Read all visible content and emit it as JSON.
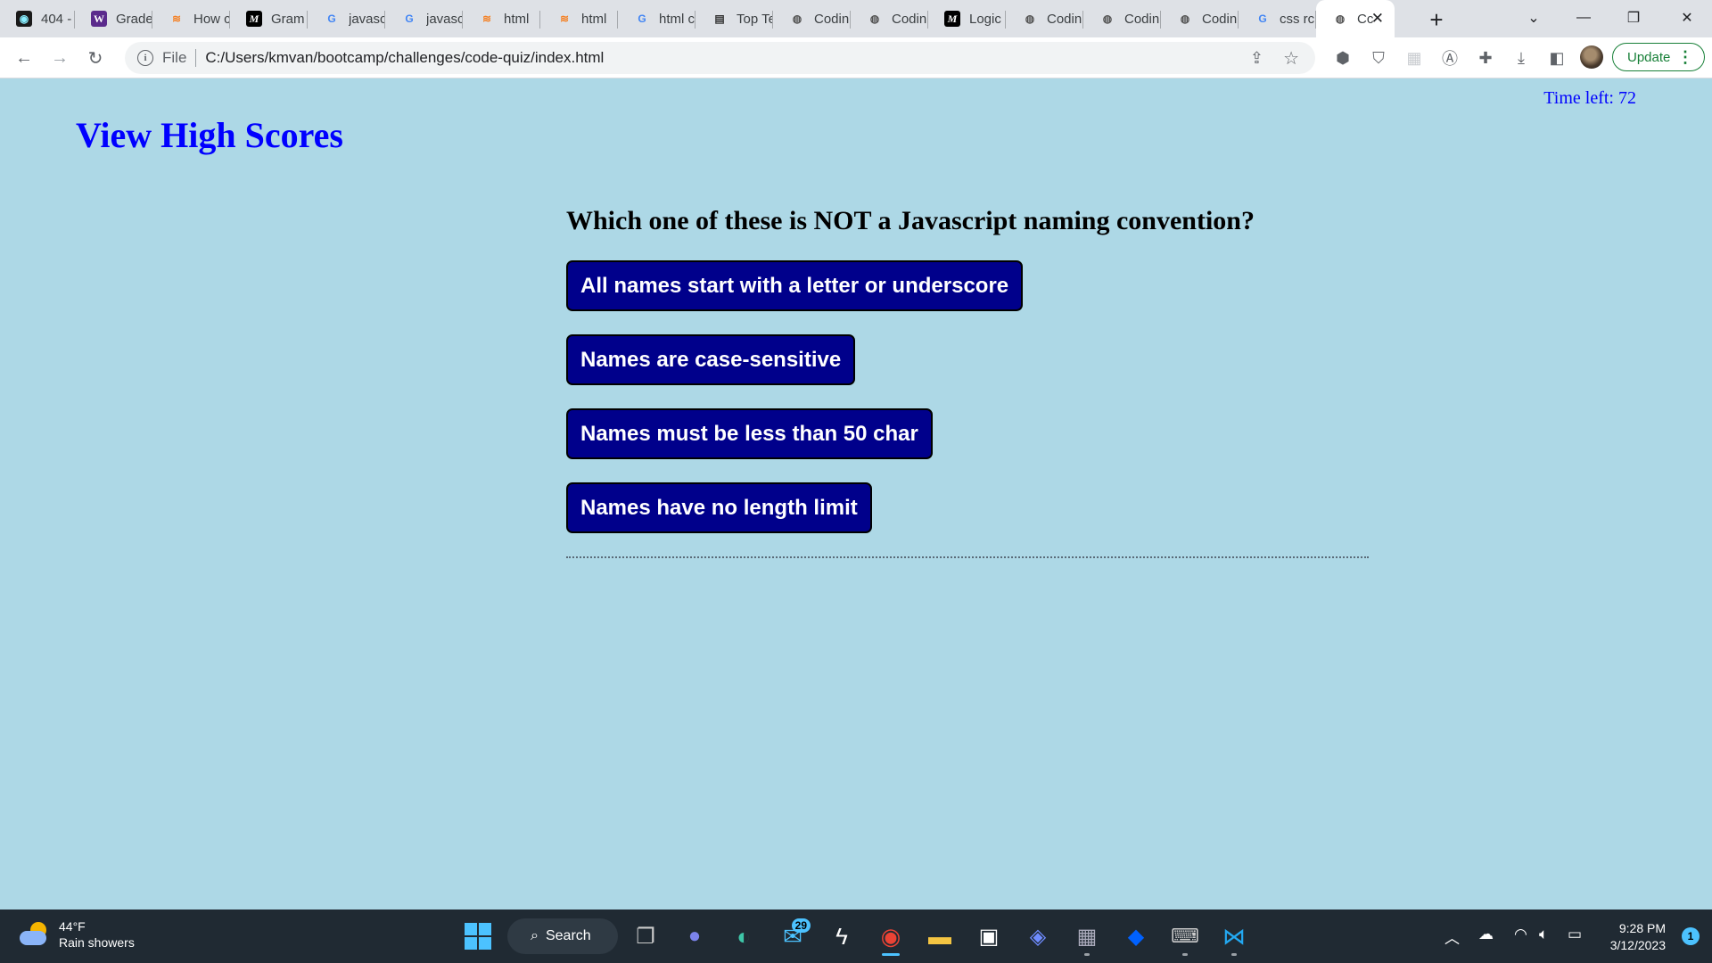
{
  "browser": {
    "tabs": [
      {
        "title": "404 -",
        "icon": "dark-circle-icon"
      },
      {
        "title": "Grade",
        "icon": "w-icon"
      },
      {
        "title": "How c",
        "icon": "stackoverflow-icon"
      },
      {
        "title": "Gram",
        "icon": "m-icon"
      },
      {
        "title": "javasc",
        "icon": "google-icon"
      },
      {
        "title": "javasc",
        "icon": "google-icon"
      },
      {
        "title": "html",
        "icon": "stackoverflow-icon"
      },
      {
        "title": "html",
        "icon": "stackoverflow-icon"
      },
      {
        "title": "html c",
        "icon": "google-icon"
      },
      {
        "title": "Top Te",
        "icon": "news-icon"
      },
      {
        "title": "Codin",
        "icon": "globe-icon"
      },
      {
        "title": "Codin",
        "icon": "globe-icon"
      },
      {
        "title": "Logic",
        "icon": "m-icon"
      },
      {
        "title": "Codin",
        "icon": "globe-icon"
      },
      {
        "title": "Codin",
        "icon": "globe-icon"
      },
      {
        "title": "Codin",
        "icon": "globe-icon"
      },
      {
        "title": "css rc",
        "icon": "google-icon"
      },
      {
        "title": "Cc",
        "icon": "globe-icon",
        "active": true
      }
    ],
    "address": {
      "protocol_label": "File",
      "url": "C:/Users/kmvan/bootcamp/challenges/code-quiz/index.html"
    },
    "update_label": "Update"
  },
  "page": {
    "view_high_scores": "View High Scores",
    "timer_label": "Time left:",
    "timer_value": "72",
    "question": "Which one of these is NOT a Javascript naming convention?",
    "answers": [
      "All names start with a letter or underscore",
      "Names are case-sensitive",
      "Names must be less than 50 char",
      "Names have no length limit"
    ]
  },
  "taskbar": {
    "weather_temp": "44°F",
    "weather_desc": "Rain showers",
    "search_label": "Search",
    "mail_badge": "29",
    "time": "9:28 PM",
    "date": "3/12/2023",
    "notification_count": "1"
  },
  "colors": {
    "page_background": "#add8e6",
    "answer_button": "#00008b",
    "link": "#0000ff"
  }
}
